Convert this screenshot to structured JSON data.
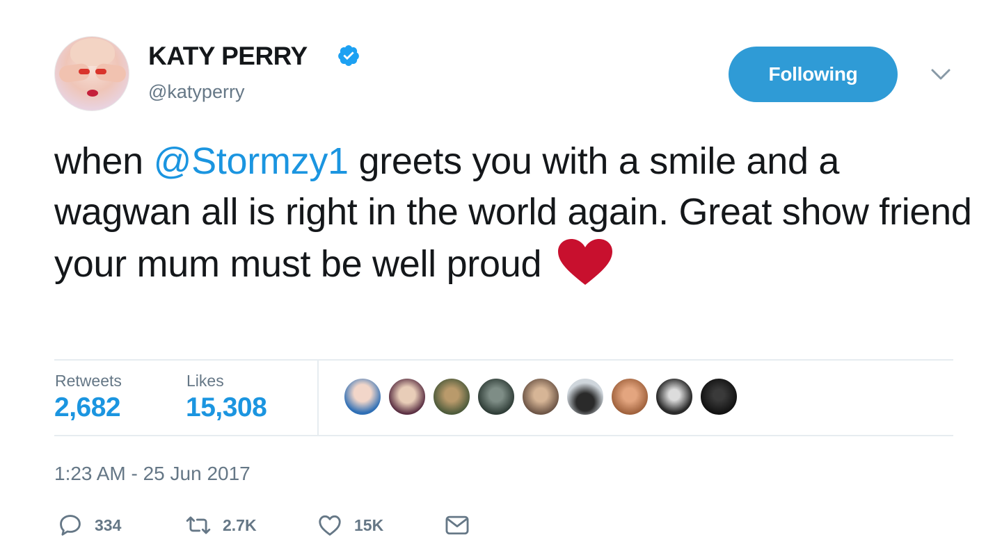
{
  "tweet": {
    "author": {
      "display_name": "KATY PERRY",
      "handle": "@katyperry",
      "verified": true
    },
    "follow_button_label": "Following",
    "text": {
      "before_mention": "when ",
      "mention": "@Stormzy1",
      "after_mention": " greets you with a smile and a wagwan all is right in the world again. Great show friend your mum must be well proud",
      "emoji": "red-heart"
    },
    "stats": {
      "retweets_label": "Retweets",
      "retweets_value": "2,682",
      "likes_label": "Likes",
      "likes_value": "15,308"
    },
    "likers_count": 9,
    "timestamp": "1:23 AM - 25 Jun 2017",
    "actions": {
      "reply_count": "334",
      "retweet_count": "2.7K",
      "like_count": "15K"
    }
  },
  "colors": {
    "accent": "#1b95e0",
    "button": "#2f9bd6",
    "secondary_text": "#657786",
    "heart": "#c8102e"
  },
  "icons": [
    "verified-badge-icon",
    "chevron-down-icon",
    "red-heart-emoji",
    "reply-icon",
    "retweet-icon",
    "like-icon",
    "direct-message-icon"
  ]
}
